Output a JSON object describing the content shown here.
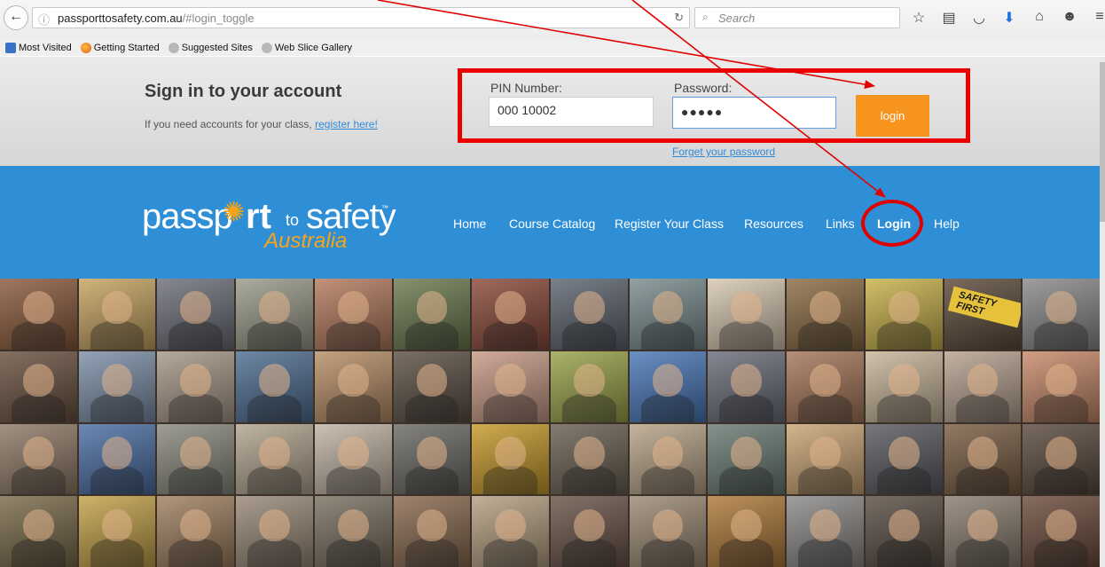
{
  "browser": {
    "url_host": "passporttosafety.com.au",
    "url_path": "/#login_toggle",
    "search_placeholder": "Search",
    "bookmarks": [
      "Most Visited",
      "Getting Started",
      "Suggested Sites",
      "Web Slice Gallery"
    ]
  },
  "login": {
    "title": "Sign in to your account",
    "note_text": "If you need accounts for your class,",
    "register_link": "register here!",
    "pin_label": "PIN Number:",
    "pin_value": "000 10002",
    "password_label": "Password:",
    "password_mask": "●●●●●",
    "login_button": "login",
    "forgot_link": "Forget your password"
  },
  "logo": {
    "part1": "passp",
    "part2": "rt",
    "part3": "to",
    "part4": "safety",
    "tm": "™",
    "sub": "Australia"
  },
  "nav": [
    "Home",
    "Course Catalog",
    "Register Your Class",
    "Resources",
    "Links",
    "Login",
    "Help"
  ],
  "collage": {
    "banner_text": "SAFETY FIRST",
    "tile_colors": [
      "#8a5a3c",
      "#c7a461",
      "#6d6f7a",
      "#9a9a8a",
      "#b57a5e",
      "#6b7a4f",
      "#8b4a3a",
      "#5d6470",
      "#7a8c8f",
      "#d7c7b0",
      "#8c6c44",
      "#c9b24a",
      "#5c4a3a",
      "#8a8a8a",
      "#6a5140",
      "#7c8fa8",
      "#a89888",
      "#4f6e92",
      "#b88e66",
      "#5c5044",
      "#c79a86",
      "#9aa34a",
      "#4a78b8",
      "#6a6e7a",
      "#a6775a",
      "#c8b69a",
      "#b7a290",
      "#c88a6a",
      "#8f7a66",
      "#4c6fa5",
      "#8a8a80",
      "#b3a58f",
      "#c1b4a4",
      "#6c6a64",
      "#c79a2a",
      "#6a6052",
      "#b8a488",
      "#6b7c74",
      "#caa574",
      "#5a5a60",
      "#7a5e44",
      "#5b4a3e",
      "#7a6a4a",
      "#c4a248",
      "#a08060",
      "#9a8a78",
      "#7a7060",
      "#8a6a50",
      "#b6a082",
      "#6a5448",
      "#9c8a74",
      "#b07a3a",
      "#8c8a88",
      "#5a4e44",
      "#8b7e70",
      "#6d4c3c"
    ]
  },
  "colors": {
    "header_blue": "#2f8fd6",
    "accent_orange": "#f7941d",
    "annotation_red": "#e00000"
  }
}
